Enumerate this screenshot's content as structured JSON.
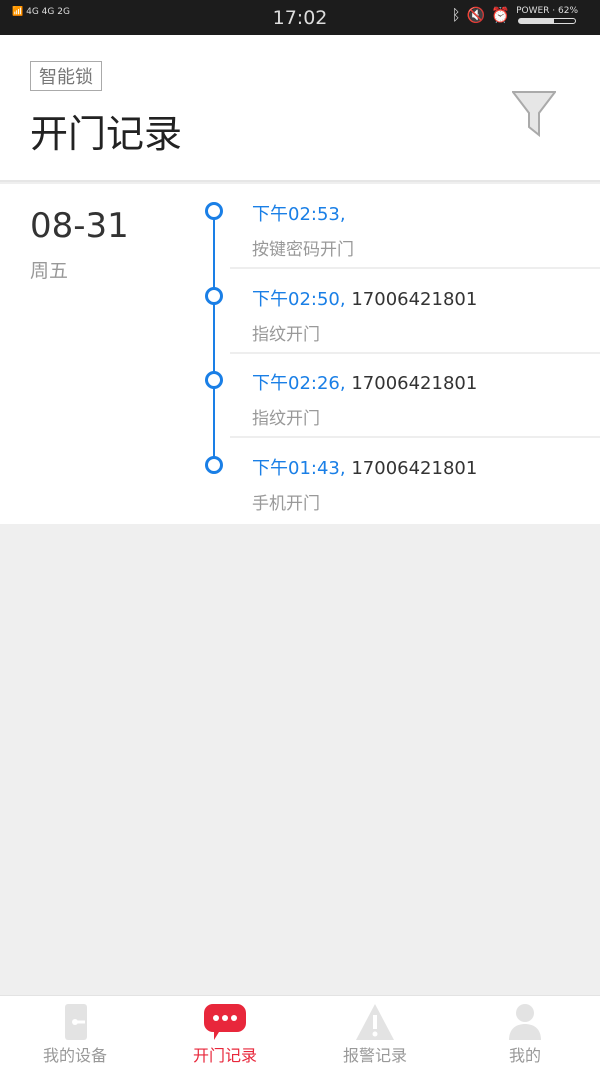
{
  "status": {
    "time": "17:02",
    "network": [
      "4G",
      "4G",
      "2G"
    ],
    "battery_label": "POWER · 62%",
    "battery_level": 0.62
  },
  "header": {
    "tag": "智能锁",
    "title": "开门记录"
  },
  "day": {
    "date": "08-31",
    "weekday": "周五"
  },
  "records": [
    {
      "time": "下午02:53,",
      "phone": "",
      "method": "按键密码开门"
    },
    {
      "time": "下午02:50,",
      "phone": "17006421801",
      "method": "指纹开门"
    },
    {
      "time": "下午02:26,",
      "phone": "17006421801",
      "method": "指纹开门"
    },
    {
      "time": "下午01:43,",
      "phone": "17006421801",
      "method": "手机开门"
    }
  ],
  "tabs": [
    {
      "label": "我的设备",
      "icon": "door-icon"
    },
    {
      "label": "开门记录",
      "icon": "chat-icon",
      "active": true
    },
    {
      "label": "报警记录",
      "icon": "warning-icon"
    },
    {
      "label": "我的",
      "icon": "person-icon"
    }
  ],
  "colors": {
    "accent": "#1a7fe6",
    "active_tab": "#e8273b"
  }
}
